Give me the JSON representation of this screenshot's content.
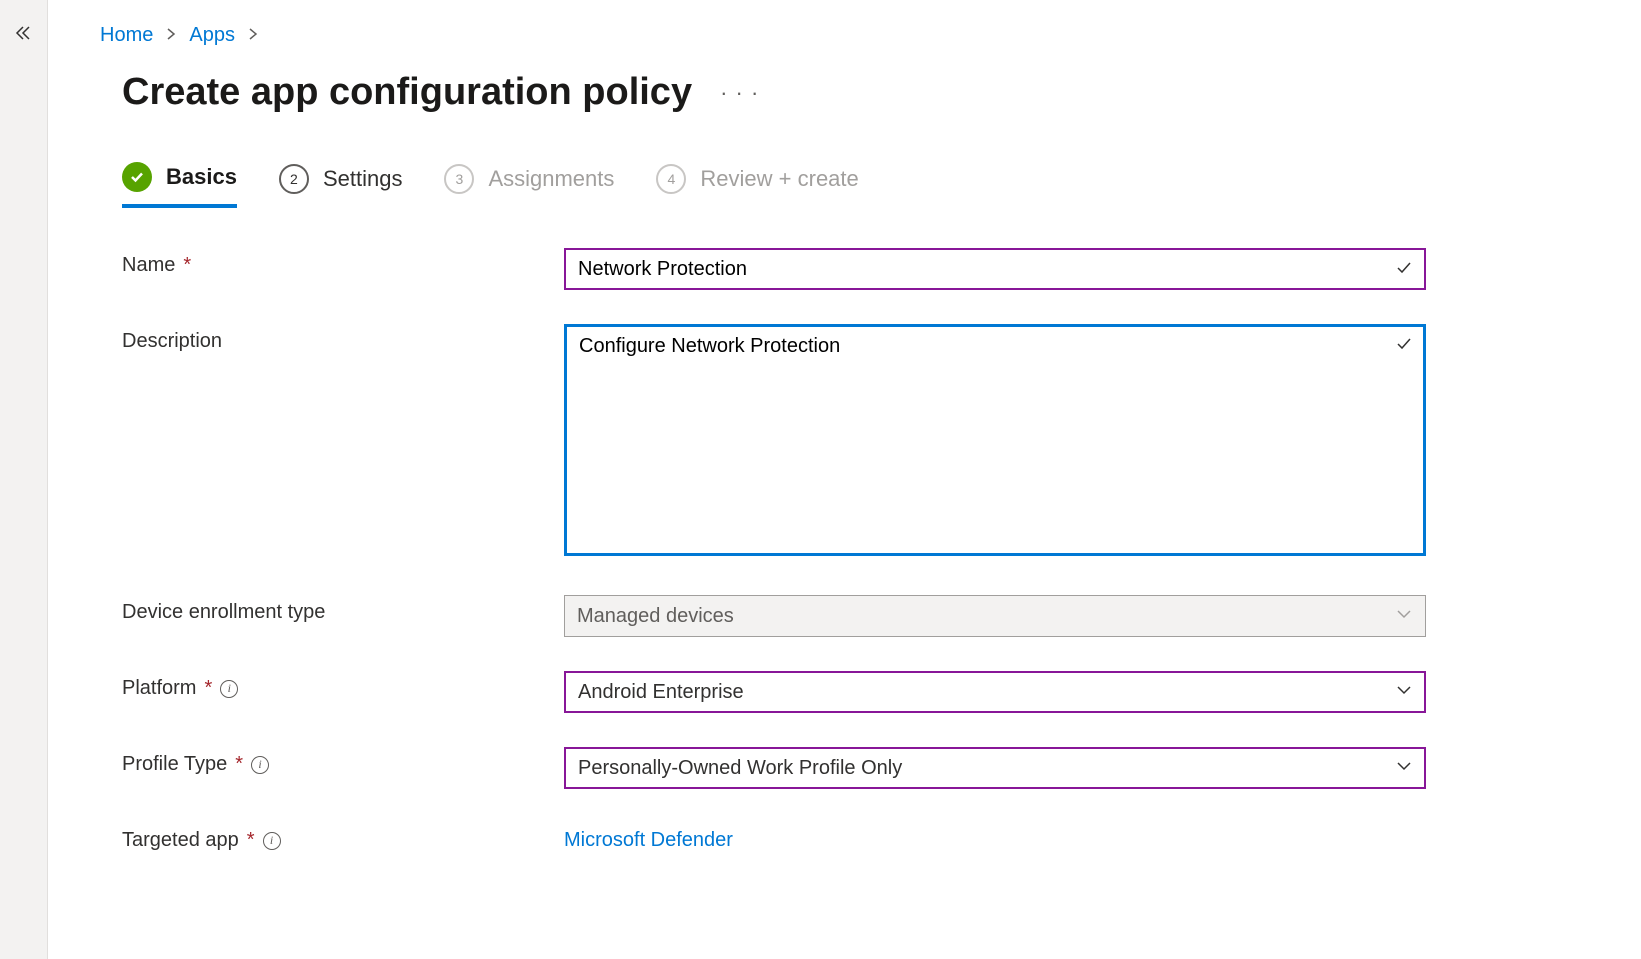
{
  "breadcrumb": {
    "home": "Home",
    "apps": "Apps"
  },
  "page": {
    "title": "Create app configuration policy"
  },
  "wizard": {
    "basics": "Basics",
    "settings": "Settings",
    "assignments": "Assignments",
    "review": "Review + create",
    "step2_num": "2",
    "step3_num": "3",
    "step4_num": "4"
  },
  "form": {
    "name_label": "Name",
    "name_value": "Network Protection",
    "description_label": "Description",
    "description_value": "Configure Network Protection",
    "enrollment_label": "Device enrollment type",
    "enrollment_value": "Managed devices",
    "platform_label": "Platform",
    "platform_value": "Android Enterprise",
    "profile_label": "Profile Type",
    "profile_value": "Personally-Owned Work Profile Only",
    "targeted_label": "Targeted app",
    "targeted_value": "Microsoft Defender"
  }
}
